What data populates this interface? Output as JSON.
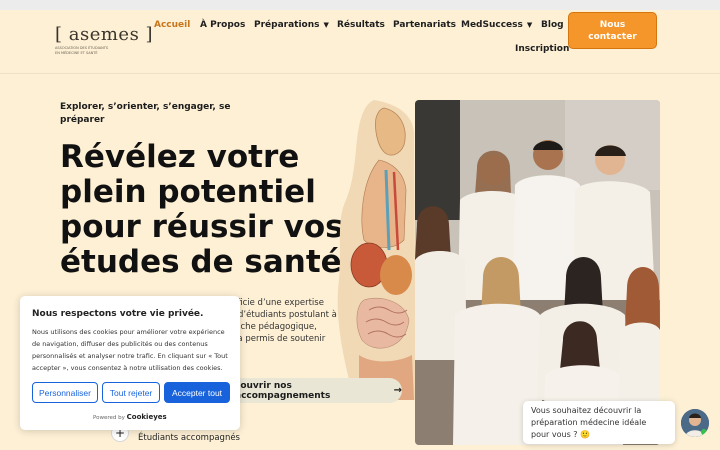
{
  "brand": {
    "logo_text": "[ asemes ]",
    "logo_tagline_1": "ASSOCIATION DES ÉTUDIANTS",
    "logo_tagline_2": "EN MÉDECINE ET SANTÉ"
  },
  "nav": {
    "items": [
      {
        "label": "Accueil",
        "active": true
      },
      {
        "label": "À Propos"
      },
      {
        "label": "Préparations",
        "has_dropdown": true
      },
      {
        "label": "Résultats"
      },
      {
        "label": "Partenariats"
      },
      {
        "label": "MedSuccess",
        "has_dropdown": true
      },
      {
        "label": "Blog"
      },
      {
        "label": "Inscription"
      }
    ],
    "cta": "Nous contacter"
  },
  "hero": {
    "eyebrow": "Explorer, s’orienter, s’engager, se préparer",
    "headline": "Révélez votre plein potentiel pour réussir vos études de santé",
    "desc_line1": "éficie d’une expertise",
    "desc_line2": "t d’étudiants postulant à",
    "desc_line3": "roche pédagogique,",
    "desc_line4": ", a permis de soutenir",
    "explore_button": "couvrir nos accompagnements",
    "students_label": "Étudiants accompagnés",
    "plus_symbol": "+"
  },
  "cookie": {
    "title": "Nous respectons votre vie privée.",
    "text": "Nous utilisons des cookies pour améliorer votre expérience de navigation, diffuser des publicités ou des contenus personnalisés et analyser notre trafic. En cliquant sur « Tout accepter », vous consentez à notre utilisation des cookies.",
    "btn_customize": "Personnaliser",
    "btn_reject": "Tout rejeter",
    "btn_accept": "Accepter tout",
    "powered_by": "Powered by",
    "powered_brand": "Cookieyes"
  },
  "chat": {
    "message": "Vous souhaitez découvrir la préparation médecine idéale pour vous ? 🙂"
  },
  "colors": {
    "background": "#fdf0d5",
    "accent": "#f5962b",
    "nav_active": "#c8751c",
    "cookie_blue": "#1863dc"
  },
  "icons": {
    "dropdown": "chevron-down-icon",
    "arrow": "arrow-right-icon"
  }
}
